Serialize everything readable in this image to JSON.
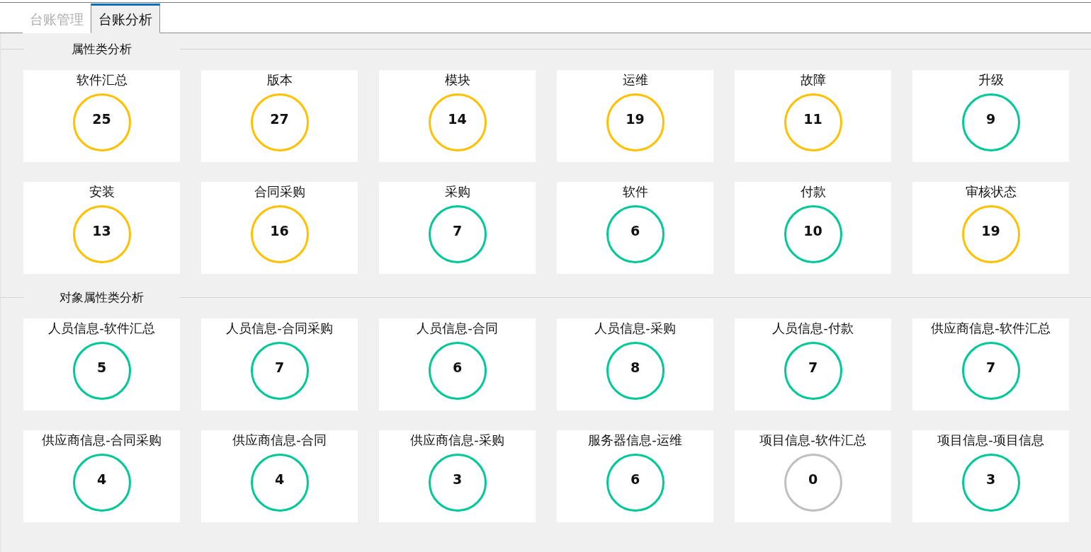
{
  "tabs": [
    {
      "label": "台账管理",
      "selected": false
    },
    {
      "label": "台账分析",
      "selected": true
    }
  ],
  "sections": [
    {
      "title": "属性类分析",
      "cards": [
        {
          "title": "软件汇总",
          "count": "25",
          "color": "#ffc000"
        },
        {
          "title": "版本",
          "count": "27",
          "color": "#ffc000"
        },
        {
          "title": "模块",
          "count": "14",
          "color": "#ffc000"
        },
        {
          "title": "运维",
          "count": "19",
          "color": "#ffc000"
        },
        {
          "title": "故障",
          "count": "11",
          "color": "#ffc000"
        },
        {
          "title": "升级",
          "count": "9",
          "color": "#00c896"
        },
        {
          "title": "安装",
          "count": "13",
          "color": "#ffc000"
        },
        {
          "title": "合同采购",
          "count": "16",
          "color": "#ffc000"
        },
        {
          "title": "采购",
          "count": "7",
          "color": "#00c896"
        },
        {
          "title": "软件",
          "count": "6",
          "color": "#00c896"
        },
        {
          "title": "付款",
          "count": "10",
          "color": "#00c896"
        },
        {
          "title": "审核状态",
          "count": "19",
          "color": "#ffc000"
        }
      ]
    },
    {
      "title": "对象属性类分析",
      "cards": [
        {
          "title": "人员信息-软件汇总",
          "count": "5",
          "color": "#00c896"
        },
        {
          "title": "人员信息-合同采购",
          "count": "7",
          "color": "#00c896"
        },
        {
          "title": "人员信息-合同",
          "count": "6",
          "color": "#00c896"
        },
        {
          "title": "人员信息-采购",
          "count": "8",
          "color": "#00c896"
        },
        {
          "title": "人员信息-付款",
          "count": "7",
          "color": "#00c896"
        },
        {
          "title": "供应商信息-软件汇总",
          "count": "7",
          "color": "#00c896"
        },
        {
          "title": "供应商信息-合同采购",
          "count": "4",
          "color": "#00c896"
        },
        {
          "title": "供应商信息-合同",
          "count": "4",
          "color": "#00c896"
        },
        {
          "title": "供应商信息-采购",
          "count": "3",
          "color": "#00c896"
        },
        {
          "title": "服务器信息-运维",
          "count": "6",
          "color": "#00c896"
        },
        {
          "title": "项目信息-软件汇总",
          "count": "0",
          "color": "#bfbfbf"
        },
        {
          "title": "项目信息-项目信息",
          "count": "3",
          "color": "#00c896"
        }
      ]
    }
  ]
}
